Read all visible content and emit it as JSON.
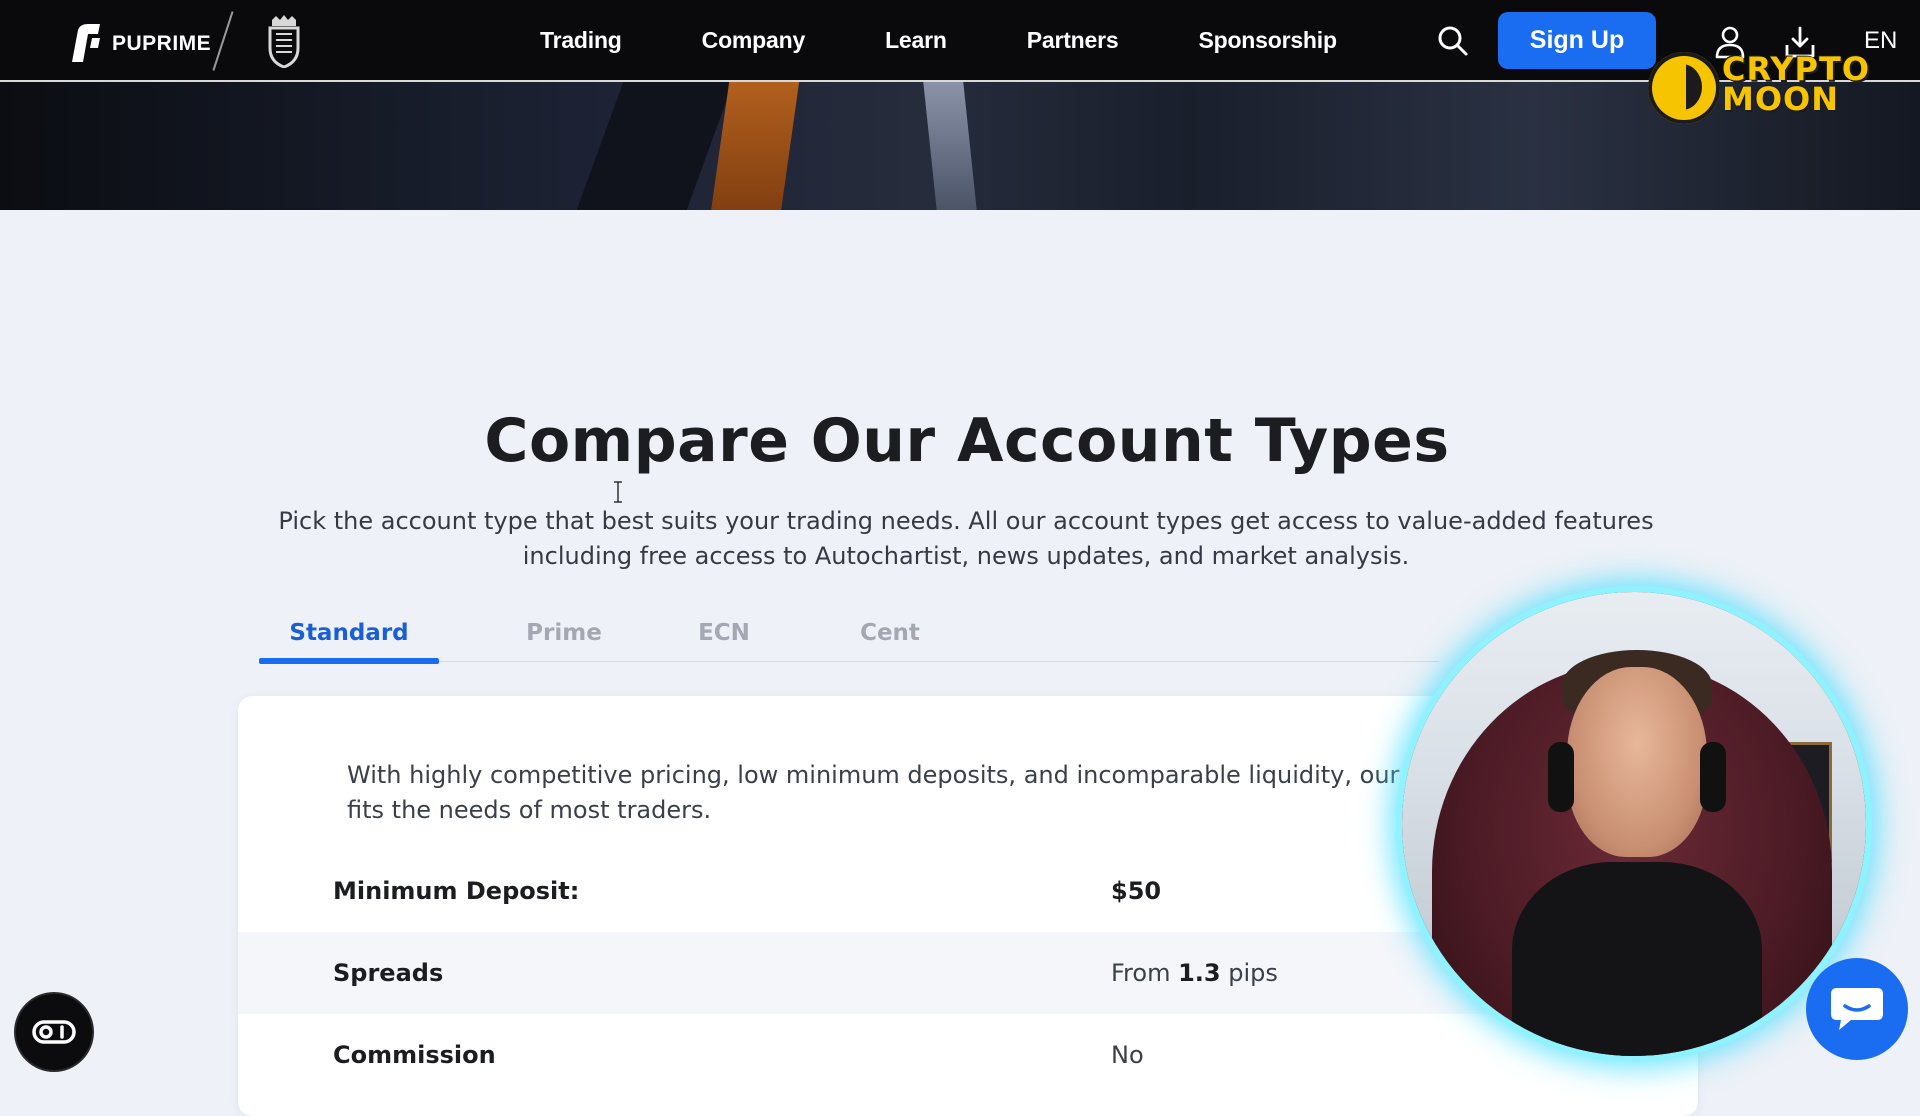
{
  "nav": {
    "brand": "PUPRIME",
    "links": [
      "Trading",
      "Company",
      "Learn",
      "Partners",
      "Sponsorship"
    ],
    "signup_label": "Sign Up",
    "language": "EN"
  },
  "watermark": {
    "line1": "CRYPTO",
    "line2": "MOON",
    "color": "#f6c400"
  },
  "main": {
    "title": "Compare Our Account Types",
    "subtitle": "Pick the account type that best suits your trading needs. All our account types get access to value-added features including free access to Autochartist, news updates, and market analysis.",
    "tabs": [
      {
        "label": "Standard",
        "active": true
      },
      {
        "label": "Prime",
        "active": false
      },
      {
        "label": "ECN",
        "active": false
      },
      {
        "label": "Cent",
        "active": false
      }
    ]
  },
  "card": {
    "description": "With highly competitive pricing, low minimum deposits, and incomparable liquidity, our Standard account fits the needs of most traders.",
    "rows": [
      {
        "label": "Minimum Deposit:",
        "value": "$50"
      },
      {
        "label": "Spreads",
        "value_prefix": "From",
        "value_strong": "1.3",
        "value_suffix": "pips"
      },
      {
        "label": "Commission",
        "value": "No"
      }
    ]
  },
  "colors": {
    "accent": "#1a6cf0",
    "nav_bg": "#0a0a0c",
    "page_bg": "#eef1f7",
    "tab_inactive": "#a3a8b3"
  },
  "icons": {
    "search": "search-icon",
    "user": "user-icon",
    "download": "download-icon",
    "chat": "chat-bubble-icon",
    "accessibility": "accessibility-icon"
  }
}
